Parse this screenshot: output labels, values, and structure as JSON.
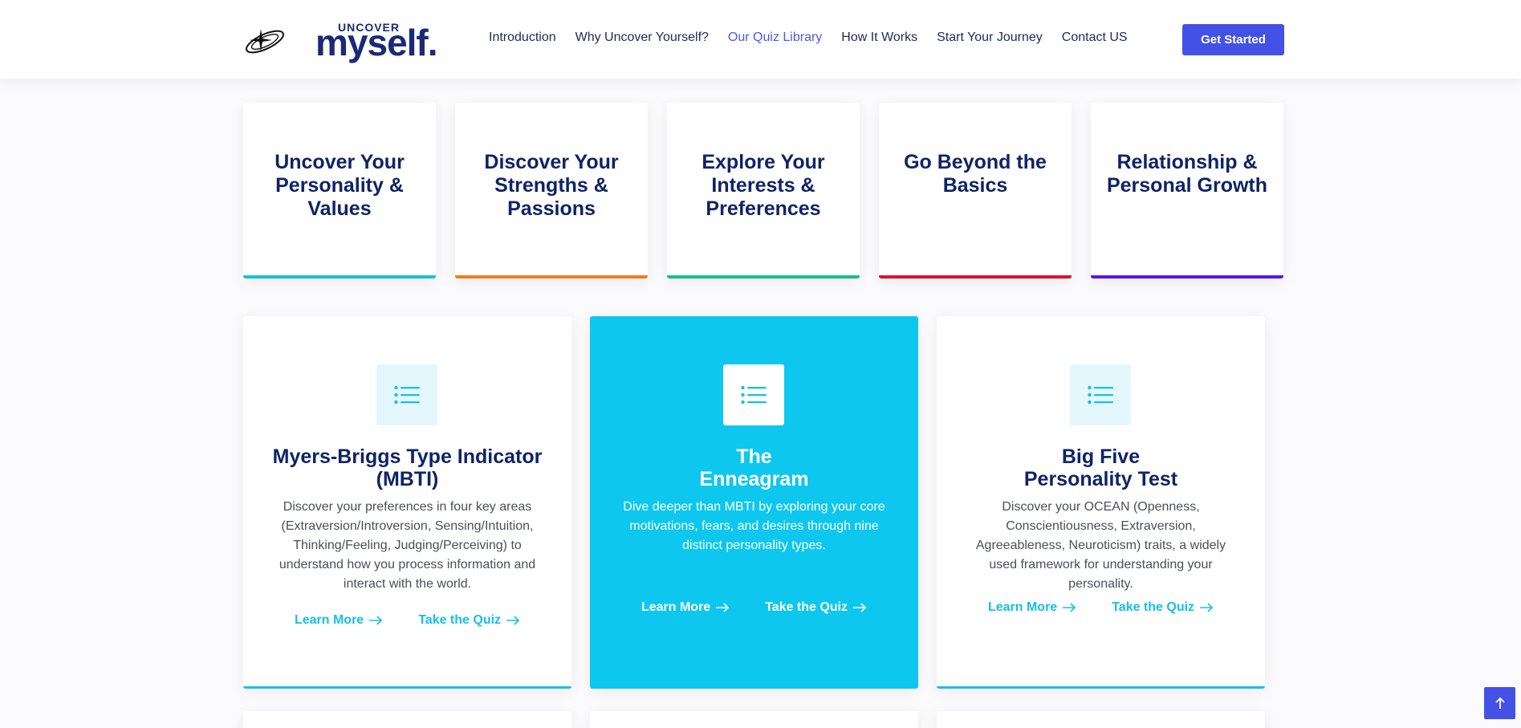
{
  "header": {
    "logo_small": "UNCOVER",
    "logo_big": "myself.",
    "nav": [
      {
        "label": "Introduction",
        "active": false
      },
      {
        "label": "Why Uncover Yourself?",
        "active": false
      },
      {
        "label": "Our Quiz Library",
        "active": true
      },
      {
        "label": "How It Works",
        "active": false
      },
      {
        "label": "Start Your Journey",
        "active": false
      },
      {
        "label": "Contact US",
        "active": false
      }
    ],
    "cta_label": "Get Started"
  },
  "categories": [
    {
      "title": "Uncover Your Personality & Values",
      "accent": "#17bfe6"
    },
    {
      "title": "Discover Your Strengths & Passions",
      "accent": "#f47a20"
    },
    {
      "title": "Explore Your Interests & Preferences",
      "accent": "#14c184"
    },
    {
      "title": "Go Beyond the Basics",
      "accent": "#e3102f"
    },
    {
      "title": "Relationship & Personal Growth",
      "accent": "#5a17e6"
    }
  ],
  "quizzes": [
    {
      "title_line1": "Myers-Briggs Type Indicator",
      "title_line2": "(MBTI)",
      "description": "Discover your preferences in four key areas (Extraversion/Introversion, Sensing/Intuition, Thinking/Feeling, Judging/Perceiving) to understand how you process information and interact with the world.",
      "learn_more": "Learn More",
      "take_quiz": "Take the Quiz",
      "icon": "list-icon",
      "highlighted": false
    },
    {
      "title_line1": "The",
      "title_line2": "Enneagram",
      "description": "Dive deeper than MBTI by exploring your core motivations, fears, and desires through nine distinct personality types.",
      "learn_more": "Learn More",
      "take_quiz": "Take the Quiz",
      "icon": "list-icon",
      "highlighted": true
    },
    {
      "title_line1": "Big Five",
      "title_line2": "Personality Test",
      "description": "Discover your OCEAN (Openness, Conscientiousness, Extraversion, Agreeableness, Neuroticism) traits, a widely used framework for understanding your personality.",
      "learn_more": "Learn More",
      "take_quiz": "Take the Quiz",
      "icon": "list-icon",
      "highlighted": false
    }
  ],
  "colors": {
    "brand": "#1b2a78",
    "accent_blue": "#4451e6",
    "cyan": "#17bfe6",
    "highlight_card": "#0ec7ee"
  }
}
